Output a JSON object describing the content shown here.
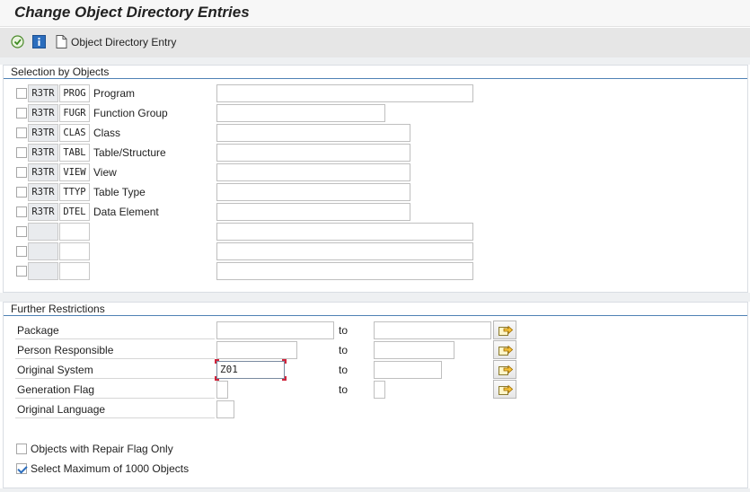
{
  "window": {
    "title": "Change Object Directory Entries"
  },
  "toolbar": {
    "object_entry_label": "Object Directory Entry"
  },
  "selection": {
    "title": "Selection by Objects",
    "rows": [
      {
        "pgmid": "R3TR",
        "type": "PROG",
        "name": "Program",
        "value": ""
      },
      {
        "pgmid": "R3TR",
        "type": "FUGR",
        "name": "Function Group",
        "value": ""
      },
      {
        "pgmid": "R3TR",
        "type": "CLAS",
        "name": "Class",
        "value": ""
      },
      {
        "pgmid": "R3TR",
        "type": "TABL",
        "name": "Table/Structure",
        "value": ""
      },
      {
        "pgmid": "R3TR",
        "type": "VIEW",
        "name": "View",
        "value": ""
      },
      {
        "pgmid": "R3TR",
        "type": "TTYP",
        "name": "Table Type",
        "value": ""
      },
      {
        "pgmid": "R3TR",
        "type": "DTEL",
        "name": "Data Element",
        "value": ""
      },
      {
        "pgmid": "",
        "type": "",
        "name": "",
        "value": ""
      },
      {
        "pgmid": "",
        "type": "",
        "name": "",
        "value": ""
      },
      {
        "pgmid": "",
        "type": "",
        "name": "",
        "value": ""
      }
    ]
  },
  "restrictions": {
    "title": "Further Restrictions",
    "to_label": "to",
    "package": {
      "label": "Package",
      "from": "",
      "to": ""
    },
    "person": {
      "label": "Person Responsible",
      "from": "",
      "to": ""
    },
    "system": {
      "label": "Original System",
      "from": "Z01",
      "to": ""
    },
    "genflag": {
      "label": "Generation Flag",
      "from": "",
      "to": ""
    },
    "language": {
      "label": "Original Language",
      "value": ""
    }
  },
  "options": {
    "repair_flag": {
      "label": "Objects with Repair Flag Only",
      "checked": false
    },
    "max_objects": {
      "label": "Select Maximum of 1000 Objects",
      "checked": true
    }
  },
  "colors": {
    "accent_line": "#4f82b5",
    "check": "#2b6dbd",
    "focus": "#d0253d"
  }
}
